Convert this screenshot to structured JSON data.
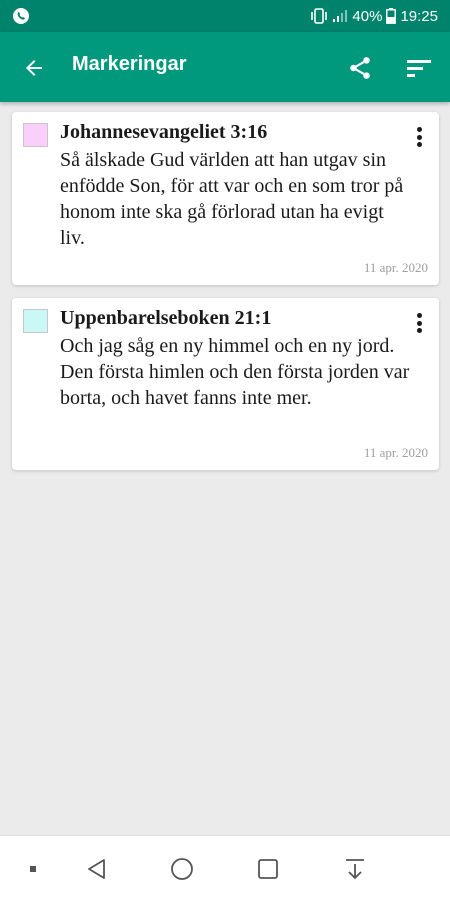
{
  "status_bar": {
    "battery": "40%",
    "time": "19:25",
    "icons": [
      "whatsapp-icon",
      "vibrate-icon",
      "signal-icon",
      "battery-icon"
    ]
  },
  "app_bar": {
    "title": "Markeringar",
    "icons": [
      "back-arrow-icon",
      "share-icon",
      "sort-icon"
    ]
  },
  "highlights": [
    {
      "reference": "Johannesevangeliet 3:16",
      "color": "#fbcffb",
      "text": "Så älskade Gud världen att han utgav sin enfödde Son, för att var och en som tror på honom inte ska gå förlorad utan ha evigt liv.",
      "date": "11 apr. 2020"
    },
    {
      "reference": "Uppenbarelseboken 21:1",
      "color": "#c9f8f6",
      "text": "Och jag såg en ny himmel och en ny jord. Den första himlen och den första jorden var borta, och havet fanns inte mer.",
      "date": "11 apr. 2020"
    }
  ],
  "nav_bar": {
    "icons": [
      "dot-icon",
      "back-triangle-icon",
      "home-circle-icon",
      "recents-square-icon",
      "download-icon"
    ]
  },
  "colors": {
    "status_bar": "#00836c",
    "app_bar": "#00997e",
    "background": "#ebebeb"
  }
}
